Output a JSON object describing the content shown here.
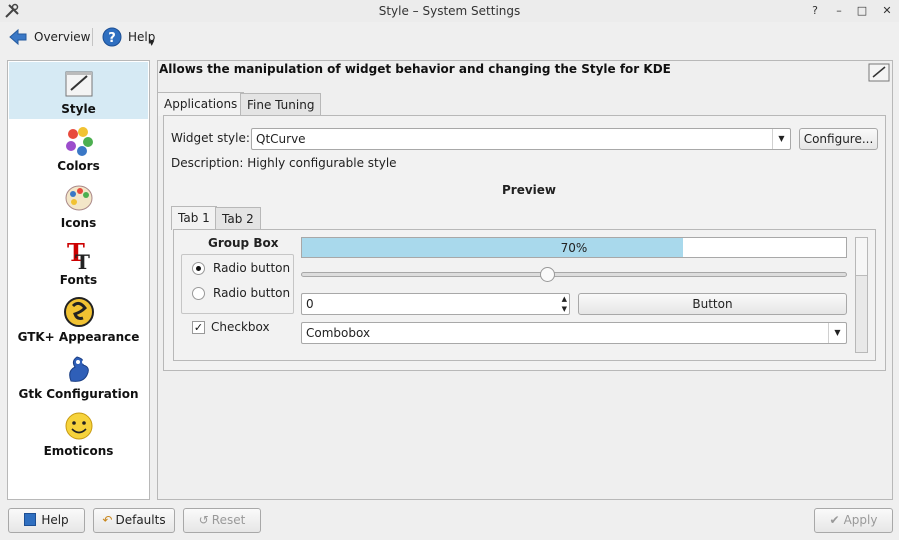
{
  "window": {
    "title": "Style – System Settings",
    "controls": [
      "?",
      "–",
      "□",
      "✕"
    ]
  },
  "toolbar": {
    "overview_label": "Overview",
    "help_label": "Help"
  },
  "sidebar": {
    "items": [
      {
        "label": "Style",
        "icon": "style-icon",
        "selected": true
      },
      {
        "label": "Colors",
        "icon": "colors-icon"
      },
      {
        "label": "Icons",
        "icon": "icons-icon"
      },
      {
        "label": "Fonts",
        "icon": "fonts-icon"
      },
      {
        "label": "GTK+ Appearance",
        "icon": "gtk-appearance-icon"
      },
      {
        "label": "Gtk Configuration",
        "icon": "gtk-configuration-icon"
      },
      {
        "label": "Emoticons",
        "icon": "emoticons-icon"
      }
    ]
  },
  "main": {
    "heading": "Allows the manipulation of widget behavior and changing the Style for KDE",
    "tabs": [
      {
        "label": "Applications",
        "active": true
      },
      {
        "label": "Fine Tuning"
      }
    ],
    "widget_style_label": "Widget style:",
    "widget_style_value": "QtCurve",
    "configure_label": "Configure...",
    "description": "Description: Highly configurable style",
    "preview": {
      "title": "Preview",
      "tabs": [
        {
          "label": "Tab 1",
          "active": true
        },
        {
          "label": "Tab 2"
        }
      ],
      "group_box_title": "Group Box",
      "radio1_label": "Radio button",
      "radio2_label": "Radio button",
      "checkbox_label": "Checkbox",
      "progress_text": "70%",
      "progress_value": 0.7,
      "slider_value": 0.45,
      "spin_value": "0",
      "button_label": "Button",
      "combobox_value": "Combobox"
    }
  },
  "bottom": {
    "help_label": "Help",
    "defaults_label": "Defaults",
    "reset_label": "Reset",
    "apply_label": "Apply"
  },
  "colors": {
    "selection": "#d6eaf4",
    "progress_fill": "#a9d9ec"
  }
}
